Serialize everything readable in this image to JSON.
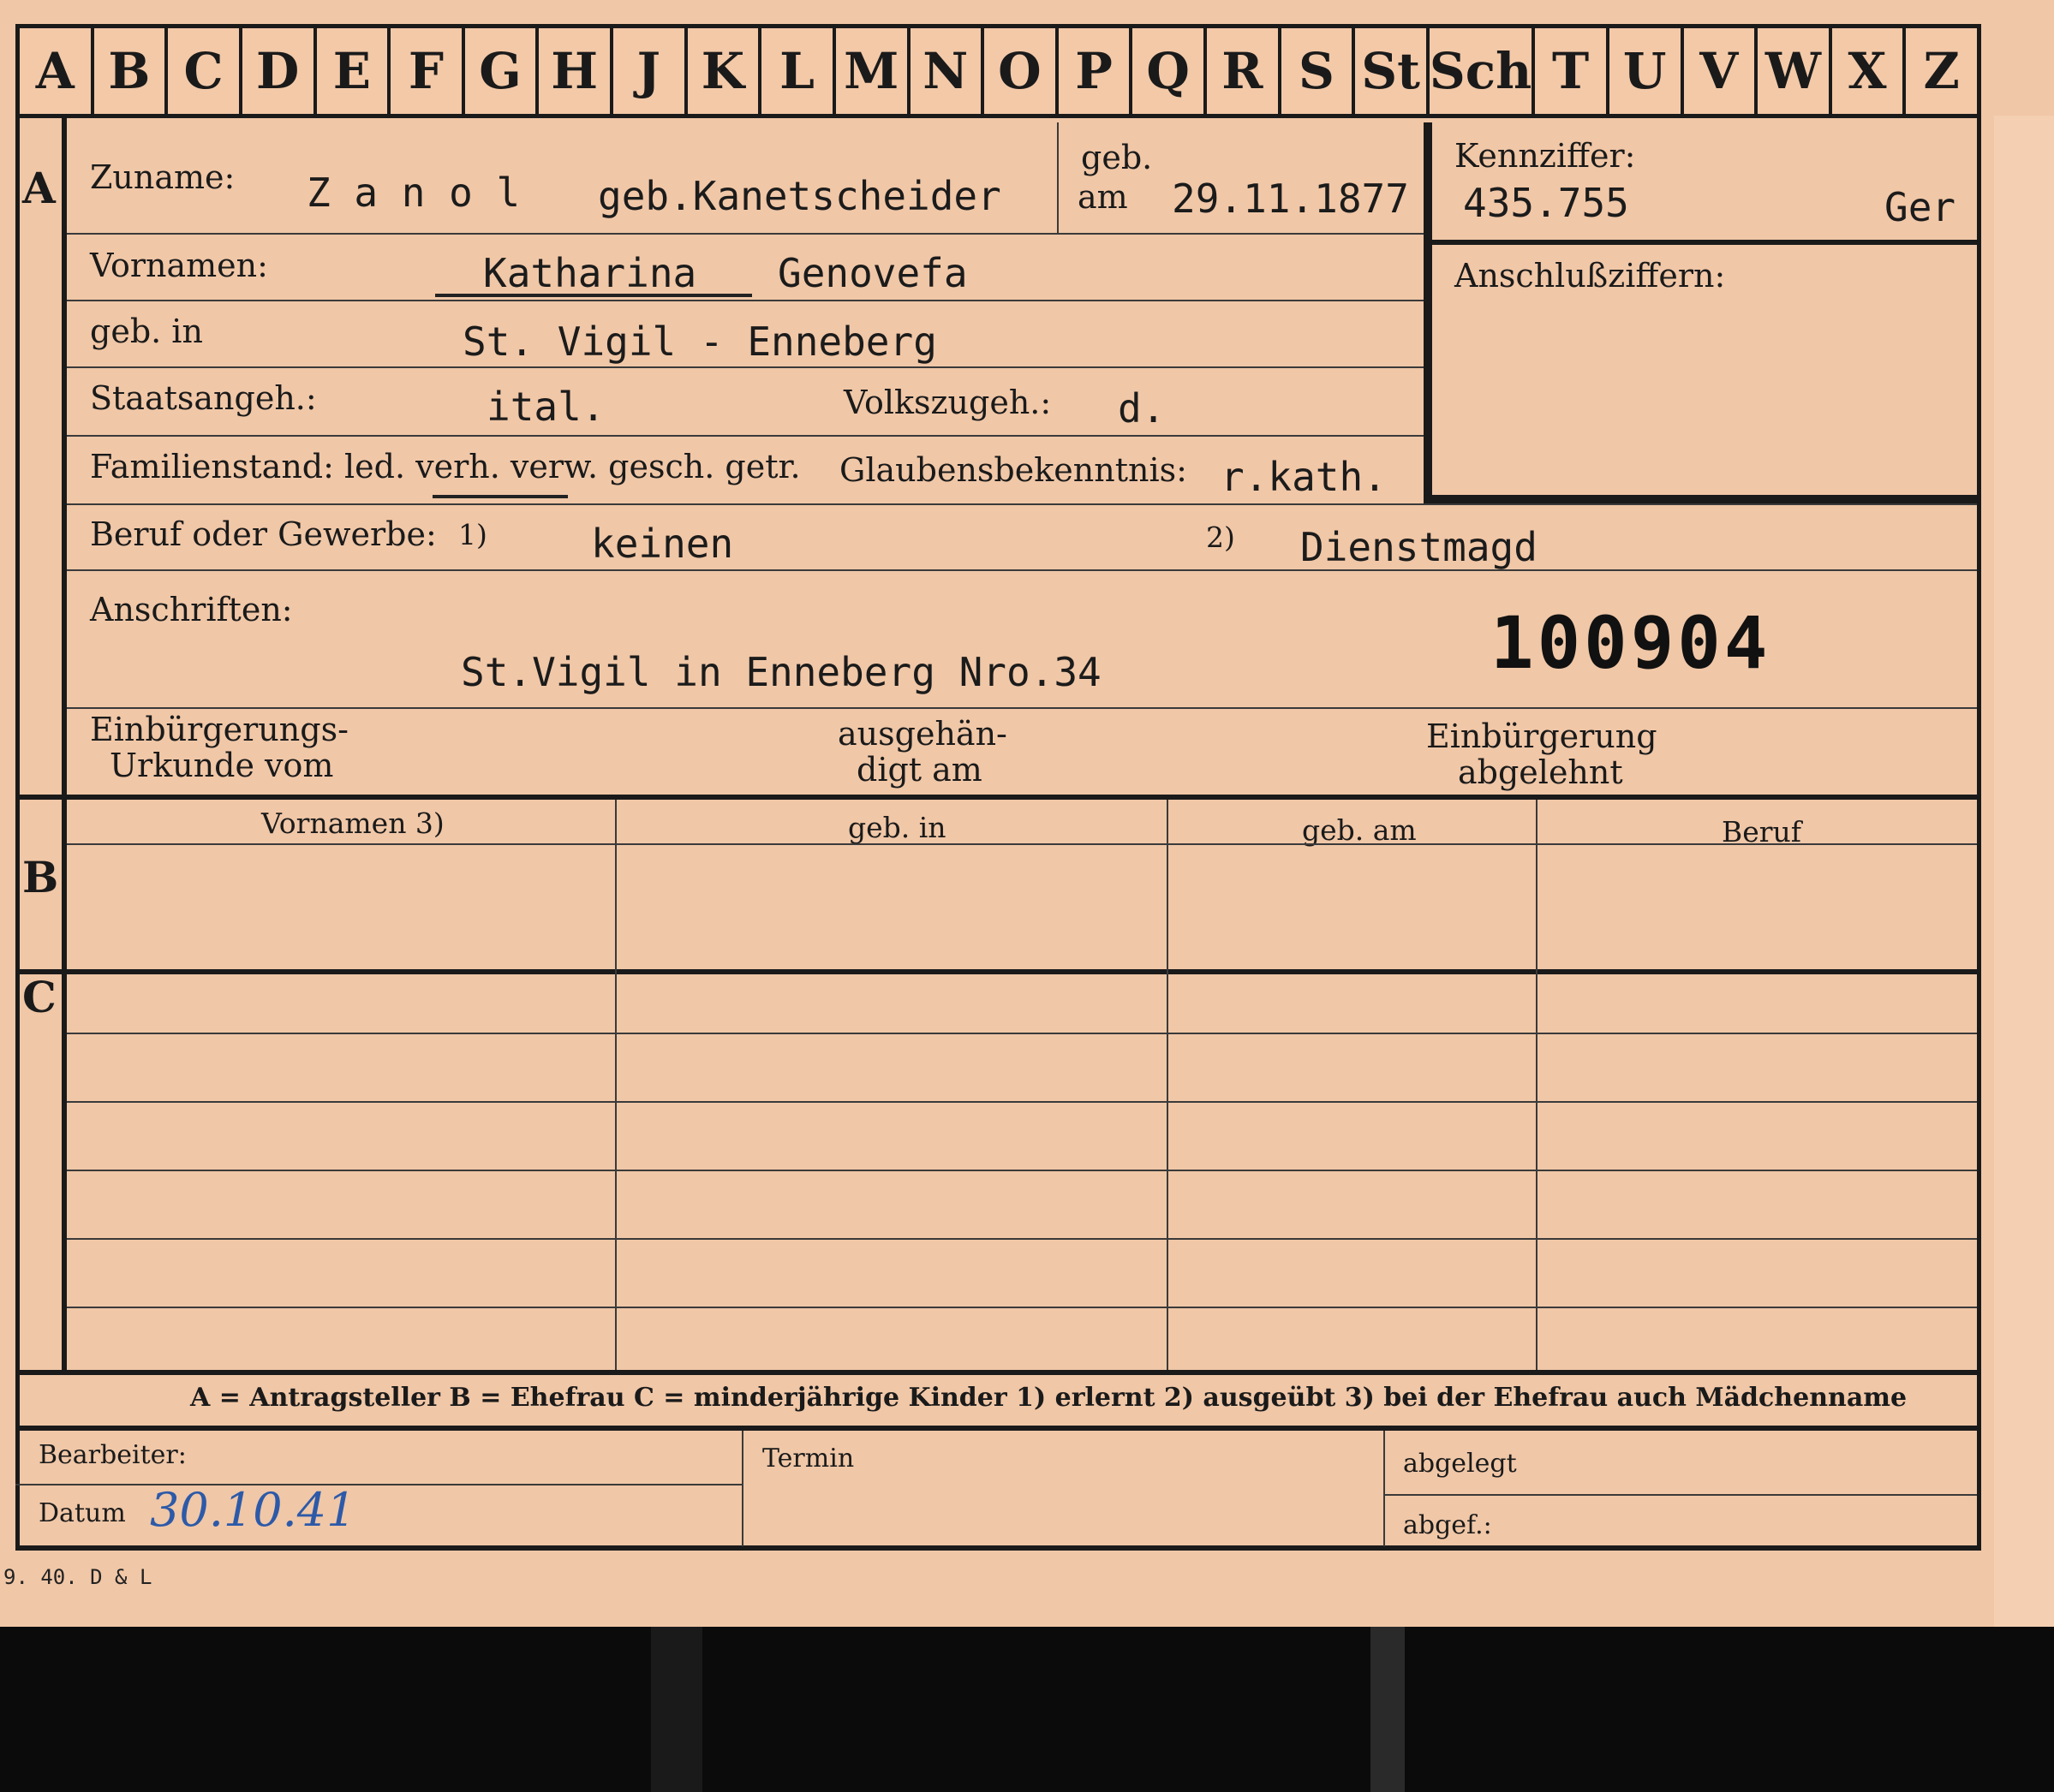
{
  "tabs": [
    "A",
    "B",
    "C",
    "D",
    "E",
    "F",
    "G",
    "H",
    "J",
    "K",
    "L",
    "M",
    "N",
    "O",
    "P",
    "Q",
    "R",
    "S",
    "St",
    "Sch",
    "T",
    "U",
    "V",
    "W",
    "X",
    "Z"
  ],
  "sections": {
    "a": "A",
    "b": "B",
    "c": "C"
  },
  "header": {
    "zuname_label": "Zuname:",
    "zuname_value": "Z a n o l",
    "geb_name": "geb.Kanetscheider",
    "geb_am_label_1": "geb.",
    "geb_am_label_2": "am",
    "geb_am_value": "29.11.1877",
    "kennziffer_label": "Kennziffer:",
    "kennziffer_value": "435.755",
    "kennziffer_suffix": "Ger",
    "anschluss_label": "Anschlußziffern:"
  },
  "fields": {
    "vornamen_label": "Vornamen:",
    "vornamen_value_1": "Katharina",
    "vornamen_value_2": "Genovefa",
    "geb_in_label": "geb. in",
    "geb_in_value": "St. Vigil - Enneberg",
    "staatsangeh_label": "Staatsangeh.:",
    "staatsangeh_value": "ital.",
    "volkszugeh_label": "Volkszugeh.:",
    "volkszugeh_value": "d.",
    "familienstand_label": "Familienstand: led. verh. verw. gesch. getr.",
    "glaubens_label": "Glaubensbekenntnis:",
    "glaubens_value": "r.kath.",
    "beruf_label": "Beruf oder Gewerbe:",
    "beruf_note_1": "1)",
    "beruf_value_1": "keinen",
    "beruf_note_2": "2)",
    "beruf_value_2": "Dienstmagd",
    "anschriften_label": "Anschriften:",
    "anschriften_value": "St.Vigil in Enneberg Nro.34",
    "stamp_number": "100904",
    "einb_urkunde_1": "Einbürgerungs-",
    "einb_urkunde_2": "Urkunde vom",
    "ausgehaendigt_1": "ausgehän-",
    "ausgehaendigt_2": "digt am",
    "einb_abgelehnt_1": "Einbürgerung",
    "einb_abgelehnt_2": "abgelehnt"
  },
  "table": {
    "headers": [
      "Vornamen 3)",
      "geb. in",
      "geb. am",
      "Beruf"
    ]
  },
  "legend": "A = Antragsteller   B = Ehefrau   C = minderjährige Kinder   1) erlernt   2) ausgeübt   3) bei der Ehefrau auch Mädchenname",
  "footer": {
    "bearbeiter_label": "Bearbeiter:",
    "datum_label": "Datum",
    "datum_value": "30.10.41",
    "termin_label": "Termin",
    "abgelegt_label": "abgelegt",
    "abgef_label": "abgef.:",
    "print_code": "9. 40. D & L"
  }
}
